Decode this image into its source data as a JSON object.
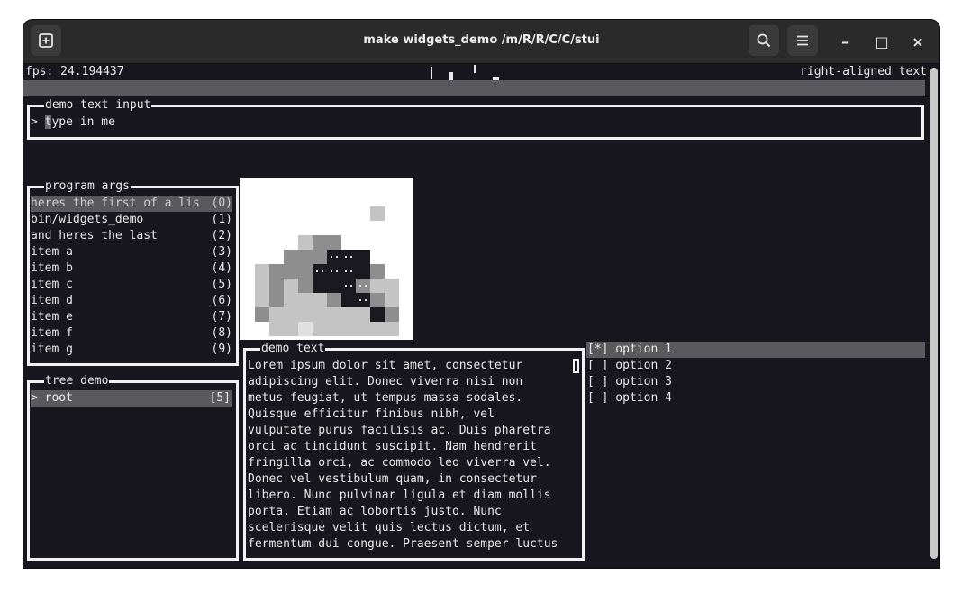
{
  "titlebar": {
    "title": "make widgets_demo  /m/R/R/C/C/stui",
    "new_tab_icon": "new-tab-icon",
    "search_icon": "search-icon",
    "menu_icon": "hamburger-menu-icon",
    "minimize_symbol": "–",
    "maximize_symbol": "□",
    "close_symbol": "×"
  },
  "top": {
    "fps": "fps: 24.194437",
    "right_text": "right-aligned text"
  },
  "text_input": {
    "title": "demo text input",
    "prompt": "> ",
    "cursor_char": "t",
    "value_rest": "ype in me"
  },
  "program_args": {
    "title": "program args",
    "items": [
      {
        "label": "heres the first of a lis",
        "index": "(0)"
      },
      {
        "label": "bin/widgets_demo",
        "index": "(1)"
      },
      {
        "label": "and heres the last",
        "index": "(2)"
      },
      {
        "label": "item a",
        "index": "(3)"
      },
      {
        "label": "item b",
        "index": "(4)"
      },
      {
        "label": "item c",
        "index": "(5)"
      },
      {
        "label": "item d",
        "index": "(6)"
      },
      {
        "label": "item e",
        "index": "(7)"
      },
      {
        "label": "item f",
        "index": "(8)"
      },
      {
        "label": "item g",
        "index": "(9)"
      }
    ]
  },
  "tree": {
    "title": "tree demo",
    "root_label": "> root",
    "root_count": "[5]"
  },
  "demo_text": {
    "title": "demo text",
    "lines": [
      "Lorem ipsum dolor sit amet, consectetur",
      "adipiscing elit. Donec viverra nisi non",
      "metus feugiat, ut tempus massa sodales.",
      "Quisque efficitur finibus nibh, vel",
      "vulputate purus facilisis ac. Duis pharetra",
      "orci ac tincidunt suscipit. Nam hendrerit",
      "fringilla orci, ac commodo leo viverra vel.",
      "Donec vel vestibulum quam, in consectetur",
      "libero. Nunc pulvinar ligula et diam mollis",
      "porta. Etiam ac lobortis justo. Nunc",
      "scelerisque velit quis lectus dictum, et",
      "fermentum dui congue. Praesent semper luctus"
    ]
  },
  "options": {
    "items": [
      {
        "label": "[*] option 1",
        "selected": true
      },
      {
        "label": "[ ] option 2",
        "selected": false
      },
      {
        "label": "[ ] option 3",
        "selected": false
      },
      {
        "label": "[ ] option 4",
        "selected": false
      }
    ]
  },
  "colors": {
    "terminal_bg": "#18161f",
    "titlebar_bg": "#2a2a2a",
    "text": "#e8e8e8",
    "highlight": "#5a5a5e"
  }
}
